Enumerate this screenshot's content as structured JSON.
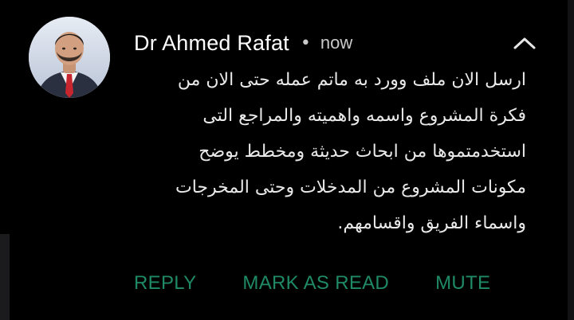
{
  "notification": {
    "sender": "Dr Ahmed Rafat",
    "separator": "•",
    "time": "now",
    "message_lines": [
      "ارسل الان ملف وورد به ماتم عمله حتى الان من",
      "فكرة المشروع واسمه واهميته والمراجع التى",
      "استخدمتموها من ابحاث حديثة ومخطط يوضح",
      "مكونات المشروع من المدخلات وحتى المخرجات",
      "واسماء الفريق واقسامهم."
    ],
    "actions": {
      "reply": "REPLY",
      "mark_as_read": "MARK AS READ",
      "mute": "MUTE"
    },
    "icons": {
      "avatar": "profile-photo",
      "collapse": "chevron-up-icon"
    },
    "colors": {
      "background": "#000000",
      "sender_text": "#ffffff",
      "body_text": "#e9e9e9",
      "action_accent": "#1f8a66"
    }
  }
}
